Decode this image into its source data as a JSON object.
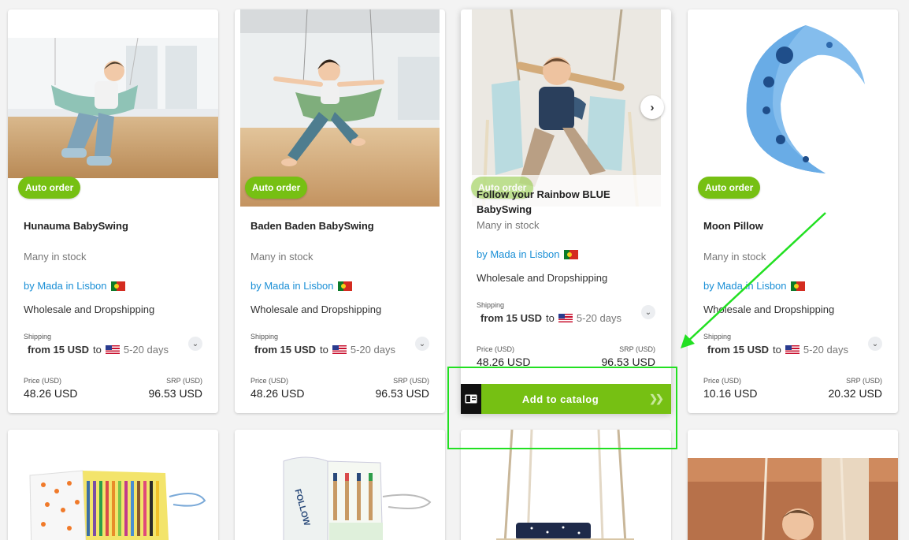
{
  "products": [
    {
      "badge": "Auto order",
      "title": "Hunauma BabySwing",
      "stock": "Many in stock",
      "seller": "by Mada in Lisbon",
      "channel": "Wholesale and Dropshipping",
      "shipping_label": "Shipping",
      "shipping_from": "from 15 USD",
      "shipping_to": "to",
      "shipping_days": "5-20 days",
      "price_label": "Price (USD)",
      "price": "48.26 USD",
      "srp_label": "SRP (USD)",
      "srp": "96.53 USD"
    },
    {
      "badge": "Auto order",
      "title": "Baden Baden BabySwing",
      "stock": "Many in stock",
      "seller": "by Mada in Lisbon",
      "channel": "Wholesale and Dropshipping",
      "shipping_label": "Shipping",
      "shipping_from": "from 15 USD",
      "shipping_to": "to",
      "shipping_days": "5-20 days",
      "price_label": "Price (USD)",
      "price": "48.26 USD",
      "srp_label": "SRP (USD)",
      "srp": "96.53 USD"
    },
    {
      "badge": "Auto order",
      "title": "Follow your Rainbow BLUE BabySwing",
      "stock": "Many in stock",
      "seller": "by Mada in Lisbon",
      "channel": "Wholesale and Dropshipping",
      "shipping_label": "Shipping",
      "shipping_from": "from 15 USD",
      "shipping_to": "to",
      "shipping_days": "5-20 days",
      "price_label": "Price (USD)",
      "price": "48.26 USD",
      "srp_label": "SRP (USD)",
      "srp": "96.53 USD",
      "add_to_catalog": "Add to catalog"
    },
    {
      "badge": "Auto order",
      "title": "Moon Pillow",
      "stock": "Many in stock",
      "seller": "by Mada in Lisbon",
      "channel": "Wholesale and Dropshipping",
      "shipping_label": "Shipping",
      "shipping_from": "from 15 USD",
      "shipping_to": "to",
      "shipping_days": "5-20 days",
      "price_label": "Price (USD)",
      "price": "10.16 USD",
      "srp_label": "SRP (USD)",
      "srp": "20.32 USD"
    }
  ],
  "second_row_images": [
    "crayon-roll-orange-dots",
    "crayon-roll-follow-rainbow",
    "wooden-swing",
    "baby-photo"
  ],
  "icons": {
    "next_image": "chevron-right-icon",
    "expand_shipping": "chevron-down-icon",
    "catalog": "catalog-icon",
    "arrows": "double-chevron-right-icon",
    "seller_flag": "portugal-flag-icon",
    "ship_flag": "usa-flag-icon"
  },
  "colors": {
    "accent": "#76c013",
    "link": "#1a8fd6",
    "annotation": "#22e022"
  }
}
